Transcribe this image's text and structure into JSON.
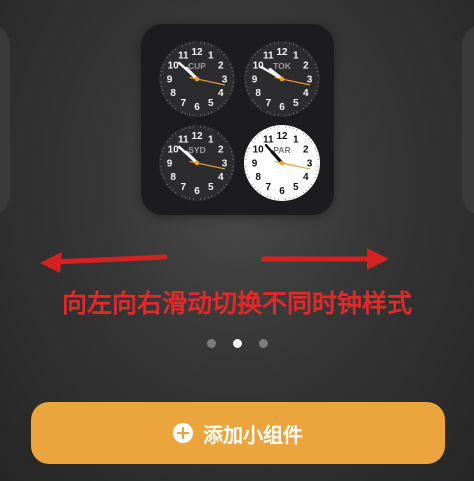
{
  "caption": "向左向右滑动切换不同时钟样式",
  "add_button": {
    "label": "添加小组件",
    "icon": "plus-circle-icon"
  },
  "pagination": {
    "count": 3,
    "active": 1
  },
  "colors": {
    "accent": "#eca43c",
    "caption": "#e22a2a",
    "second_hand": "#f0a030"
  },
  "clocks": [
    {
      "city": "CUP",
      "theme": "dark",
      "hour": 10.5,
      "minute": 52,
      "second": 17
    },
    {
      "city": "TOK",
      "theme": "dark",
      "hour": 10.3,
      "minute": 50,
      "second": 17
    },
    {
      "city": "SYD",
      "theme": "dark",
      "hour": 10.5,
      "minute": 52,
      "second": 17
    },
    {
      "city": "PAR",
      "theme": "light",
      "hour": 10.6,
      "minute": 53,
      "second": 17
    }
  ]
}
